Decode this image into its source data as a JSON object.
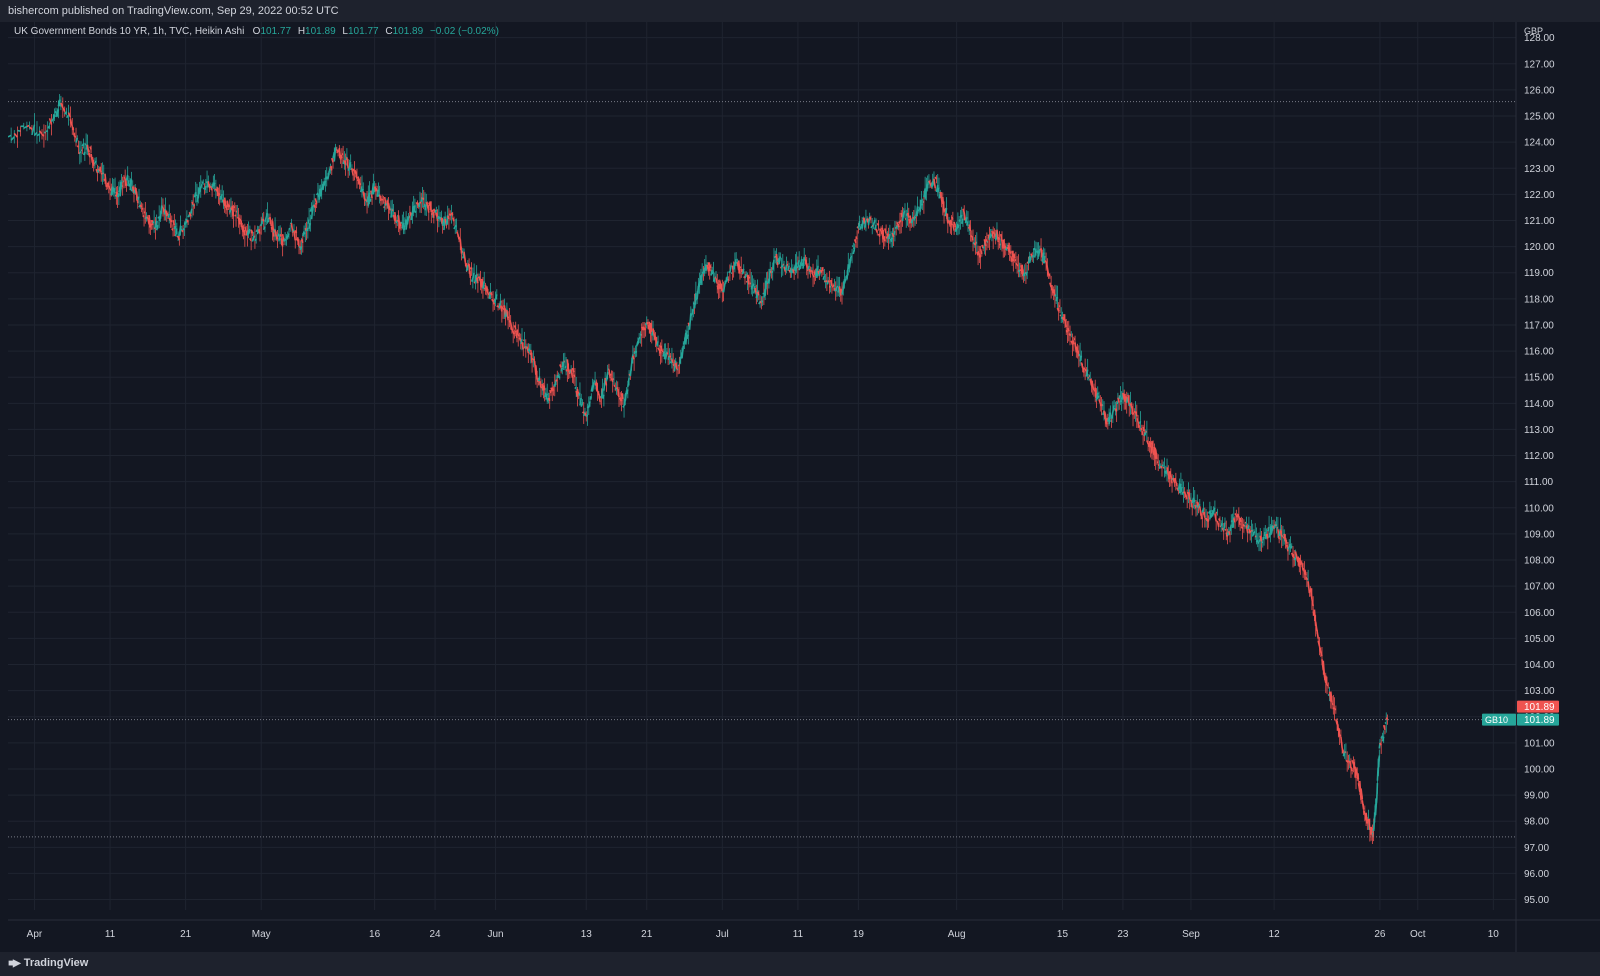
{
  "header": {
    "published": "bishercom published on TradingView.com, Sep 29, 2022 00:52 UTC"
  },
  "legend": {
    "symbol": "UK Government Bonds 10 YR, 1h, TVC, Heikin Ashi",
    "o_label": "O",
    "o_value": "101.77",
    "h_label": "H",
    "h_value": "101.89",
    "l_label": "L",
    "l_value": "101.77",
    "c_label": "C",
    "c_value": "101.89",
    "change": "−0.02 (−0.02%)"
  },
  "footer": {
    "brand": "TradingView"
  },
  "colors": {
    "background": "#131722",
    "up": "#26a69a",
    "down": "#ef5350",
    "grid": "#1f2430",
    "axis_text": "#d1d4dc"
  },
  "chart_data": {
    "type": "line",
    "chart_style": "heikin-ashi candles",
    "currency_label": "GBP",
    "y_ticks": [
      "95.00",
      "96.00",
      "97.00",
      "98.00",
      "99.00",
      "100.00",
      "101.00",
      "102.00",
      "103.00",
      "104.00",
      "105.00",
      "106.00",
      "107.00",
      "108.00",
      "109.00",
      "110.00",
      "111.00",
      "112.00",
      "113.00",
      "114.00",
      "115.00",
      "116.00",
      "117.00",
      "118.00",
      "119.00",
      "120.00",
      "121.00",
      "122.00",
      "123.00",
      "124.00",
      "125.00",
      "126.00",
      "127.00",
      "128.00"
    ],
    "ylim": [
      94.6,
      128.6
    ],
    "x_ticks": [
      {
        "label": "Apr",
        "x": 0
      },
      {
        "label": "11",
        "x": 10
      },
      {
        "label": "21",
        "x": 20
      },
      {
        "label": "May",
        "x": 30
      },
      {
        "label": "16",
        "x": 45
      },
      {
        "label": "24",
        "x": 53
      },
      {
        "label": "Jun",
        "x": 61
      },
      {
        "label": "13",
        "x": 73
      },
      {
        "label": "21",
        "x": 81
      },
      {
        "label": "Jul",
        "x": 91
      },
      {
        "label": "11",
        "x": 101
      },
      {
        "label": "19",
        "x": 109
      },
      {
        "label": "Aug",
        "x": 122
      },
      {
        "label": "15",
        "x": 136
      },
      {
        "label": "23",
        "x": 144
      },
      {
        "label": "Sep",
        "x": 153
      },
      {
        "label": "12",
        "x": 164
      },
      {
        "label": "26",
        "x": 178
      },
      {
        "label": "Oct",
        "x": 183
      },
      {
        "label": "10",
        "x": 193
      }
    ],
    "xlim": [
      -3.5,
      196
    ],
    "reference_lines": [
      {
        "value": 125.55,
        "style": "dotted"
      },
      {
        "value": 97.4,
        "style": "dotted"
      }
    ],
    "last_price": "101.89",
    "last_price_value": 101.89,
    "price_tag_prev": "101.89",
    "symbol_tag": "GB10",
    "series": [
      {
        "points": [
          [
            -3.5,
            124.2
          ],
          [
            -1,
            124.6
          ],
          [
            1,
            124.3
          ],
          [
            2.5,
            124.9
          ],
          [
            3.5,
            125.5
          ],
          [
            5,
            124.6
          ],
          [
            6,
            123.6
          ],
          [
            7,
            123.9
          ],
          [
            8,
            123.2
          ],
          [
            9,
            122.8
          ],
          [
            10,
            122.2
          ],
          [
            11,
            121.9
          ],
          [
            12,
            122.6
          ],
          [
            13,
            122.3
          ],
          [
            14,
            121.6
          ],
          [
            15,
            121.1
          ],
          [
            16,
            120.7
          ],
          [
            17,
            121.5
          ],
          [
            18,
            121.0
          ],
          [
            19,
            120.4
          ],
          [
            20,
            120.9
          ],
          [
            21,
            121.6
          ],
          [
            22,
            122.3
          ],
          [
            23,
            122.5
          ],
          [
            24,
            122.2
          ],
          [
            25,
            121.8
          ],
          [
            26,
            121.5
          ],
          [
            27,
            121.1
          ],
          [
            28,
            120.6
          ],
          [
            29,
            120.4
          ],
          [
            30,
            120.8
          ],
          [
            31,
            121.1
          ],
          [
            32,
            120.4
          ],
          [
            33,
            120.2
          ],
          [
            34,
            120.9
          ],
          [
            35,
            120.0
          ],
          [
            36,
            120.6
          ],
          [
            37,
            121.6
          ],
          [
            38,
            122.2
          ],
          [
            39,
            122.9
          ],
          [
            40,
            123.7
          ],
          [
            41,
            123.3
          ],
          [
            42,
            123.0
          ],
          [
            43,
            122.4
          ],
          [
            44,
            121.7
          ],
          [
            45,
            122.3
          ],
          [
            46,
            121.8
          ],
          [
            47,
            121.4
          ],
          [
            48,
            121.0
          ],
          [
            49,
            120.8
          ],
          [
            50,
            121.3
          ],
          [
            51,
            121.7
          ],
          [
            52,
            121.6
          ],
          [
            53,
            121.3
          ],
          [
            54,
            120.8
          ],
          [
            55,
            121.2
          ],
          [
            56,
            120.5
          ],
          [
            57,
            119.4
          ],
          [
            58,
            118.8
          ],
          [
            59,
            118.7
          ],
          [
            60,
            118.2
          ],
          [
            61,
            118.0
          ],
          [
            62,
            117.6
          ],
          [
            63,
            117.1
          ],
          [
            64,
            116.6
          ],
          [
            65,
            116.1
          ],
          [
            66,
            115.7
          ],
          [
            67,
            114.6
          ],
          [
            68,
            114.2
          ],
          [
            69,
            114.9
          ],
          [
            70,
            115.6
          ],
          [
            71,
            115.3
          ],
          [
            72,
            114.3
          ],
          [
            73,
            113.5
          ],
          [
            74,
            114.8
          ],
          [
            75,
            114.2
          ],
          [
            76,
            115.3
          ],
          [
            77,
            114.6
          ],
          [
            78,
            113.9
          ],
          [
            79,
            115.5
          ],
          [
            80,
            116.5
          ],
          [
            81,
            117.1
          ],
          [
            82,
            116.6
          ],
          [
            83,
            116.0
          ],
          [
            84,
            115.8
          ],
          [
            85,
            115.3
          ],
          [
            86,
            116.3
          ],
          [
            87,
            117.4
          ],
          [
            88,
            118.6
          ],
          [
            89,
            119.3
          ],
          [
            90,
            118.8
          ],
          [
            91,
            118.3
          ],
          [
            92,
            119.0
          ],
          [
            93,
            119.4
          ],
          [
            94,
            118.8
          ],
          [
            95,
            118.5
          ],
          [
            96,
            117.9
          ],
          [
            97,
            118.6
          ],
          [
            98,
            119.6
          ],
          [
            99,
            119.3
          ],
          [
            100,
            119.0
          ],
          [
            101,
            119.2
          ],
          [
            102,
            119.5
          ],
          [
            103,
            118.9
          ],
          [
            104,
            119.1
          ],
          [
            105,
            118.7
          ],
          [
            106,
            118.3
          ],
          [
            107,
            118.4
          ],
          [
            108,
            119.6
          ],
          [
            109,
            120.7
          ],
          [
            110,
            121.0
          ],
          [
            111,
            120.8
          ],
          [
            112,
            120.6
          ],
          [
            113,
            120.3
          ],
          [
            114,
            120.7
          ],
          [
            115,
            121.3
          ],
          [
            116,
            120.9
          ],
          [
            117,
            121.4
          ],
          [
            118,
            122.2
          ],
          [
            119,
            122.6
          ],
          [
            120,
            121.8
          ],
          [
            121,
            121.0
          ],
          [
            122,
            120.7
          ],
          [
            123,
            121.3
          ],
          [
            124,
            120.4
          ],
          [
            125,
            119.7
          ],
          [
            126,
            120.2
          ],
          [
            127,
            120.5
          ],
          [
            128,
            120.2
          ],
          [
            129,
            119.8
          ],
          [
            130,
            119.3
          ],
          [
            131,
            119.0
          ],
          [
            132,
            119.6
          ],
          [
            133,
            119.9
          ],
          [
            134,
            119.2
          ],
          [
            135,
            118.1
          ],
          [
            136,
            117.3
          ],
          [
            137,
            116.6
          ],
          [
            138,
            116.0
          ],
          [
            139,
            115.3
          ],
          [
            140,
            114.6
          ],
          [
            141,
            114.0
          ],
          [
            142,
            113.3
          ],
          [
            143,
            113.8
          ],
          [
            144,
            114.4
          ],
          [
            145,
            114.0
          ],
          [
            146,
            113.3
          ],
          [
            147,
            112.9
          ],
          [
            148,
            112.2
          ],
          [
            149,
            111.6
          ],
          [
            150,
            111.3
          ],
          [
            151,
            111.0
          ],
          [
            152,
            110.6
          ],
          [
            153,
            110.3
          ],
          [
            154,
            110.0
          ],
          [
            155,
            109.6
          ],
          [
            156,
            109.9
          ],
          [
            157,
            109.3
          ],
          [
            158,
            109.1
          ],
          [
            159,
            109.7
          ],
          [
            160,
            109.3
          ],
          [
            161,
            109.1
          ],
          [
            162,
            108.7
          ],
          [
            163,
            109.0
          ],
          [
            164,
            109.2
          ],
          [
            165,
            108.9
          ],
          [
            166,
            108.5
          ],
          [
            167,
            108.1
          ],
          [
            168,
            107.6
          ],
          [
            169,
            106.5
          ],
          [
            170,
            104.7
          ],
          [
            171,
            103.2
          ],
          [
            172,
            102.3
          ],
          [
            173,
            100.8
          ],
          [
            174,
            100.3
          ],
          [
            175,
            99.8
          ],
          [
            176,
            98.3
          ],
          [
            177,
            97.5
          ],
          [
            177.5,
            98.6
          ],
          [
            178,
            101.0
          ],
          [
            179,
            101.89
          ]
        ]
      }
    ]
  }
}
